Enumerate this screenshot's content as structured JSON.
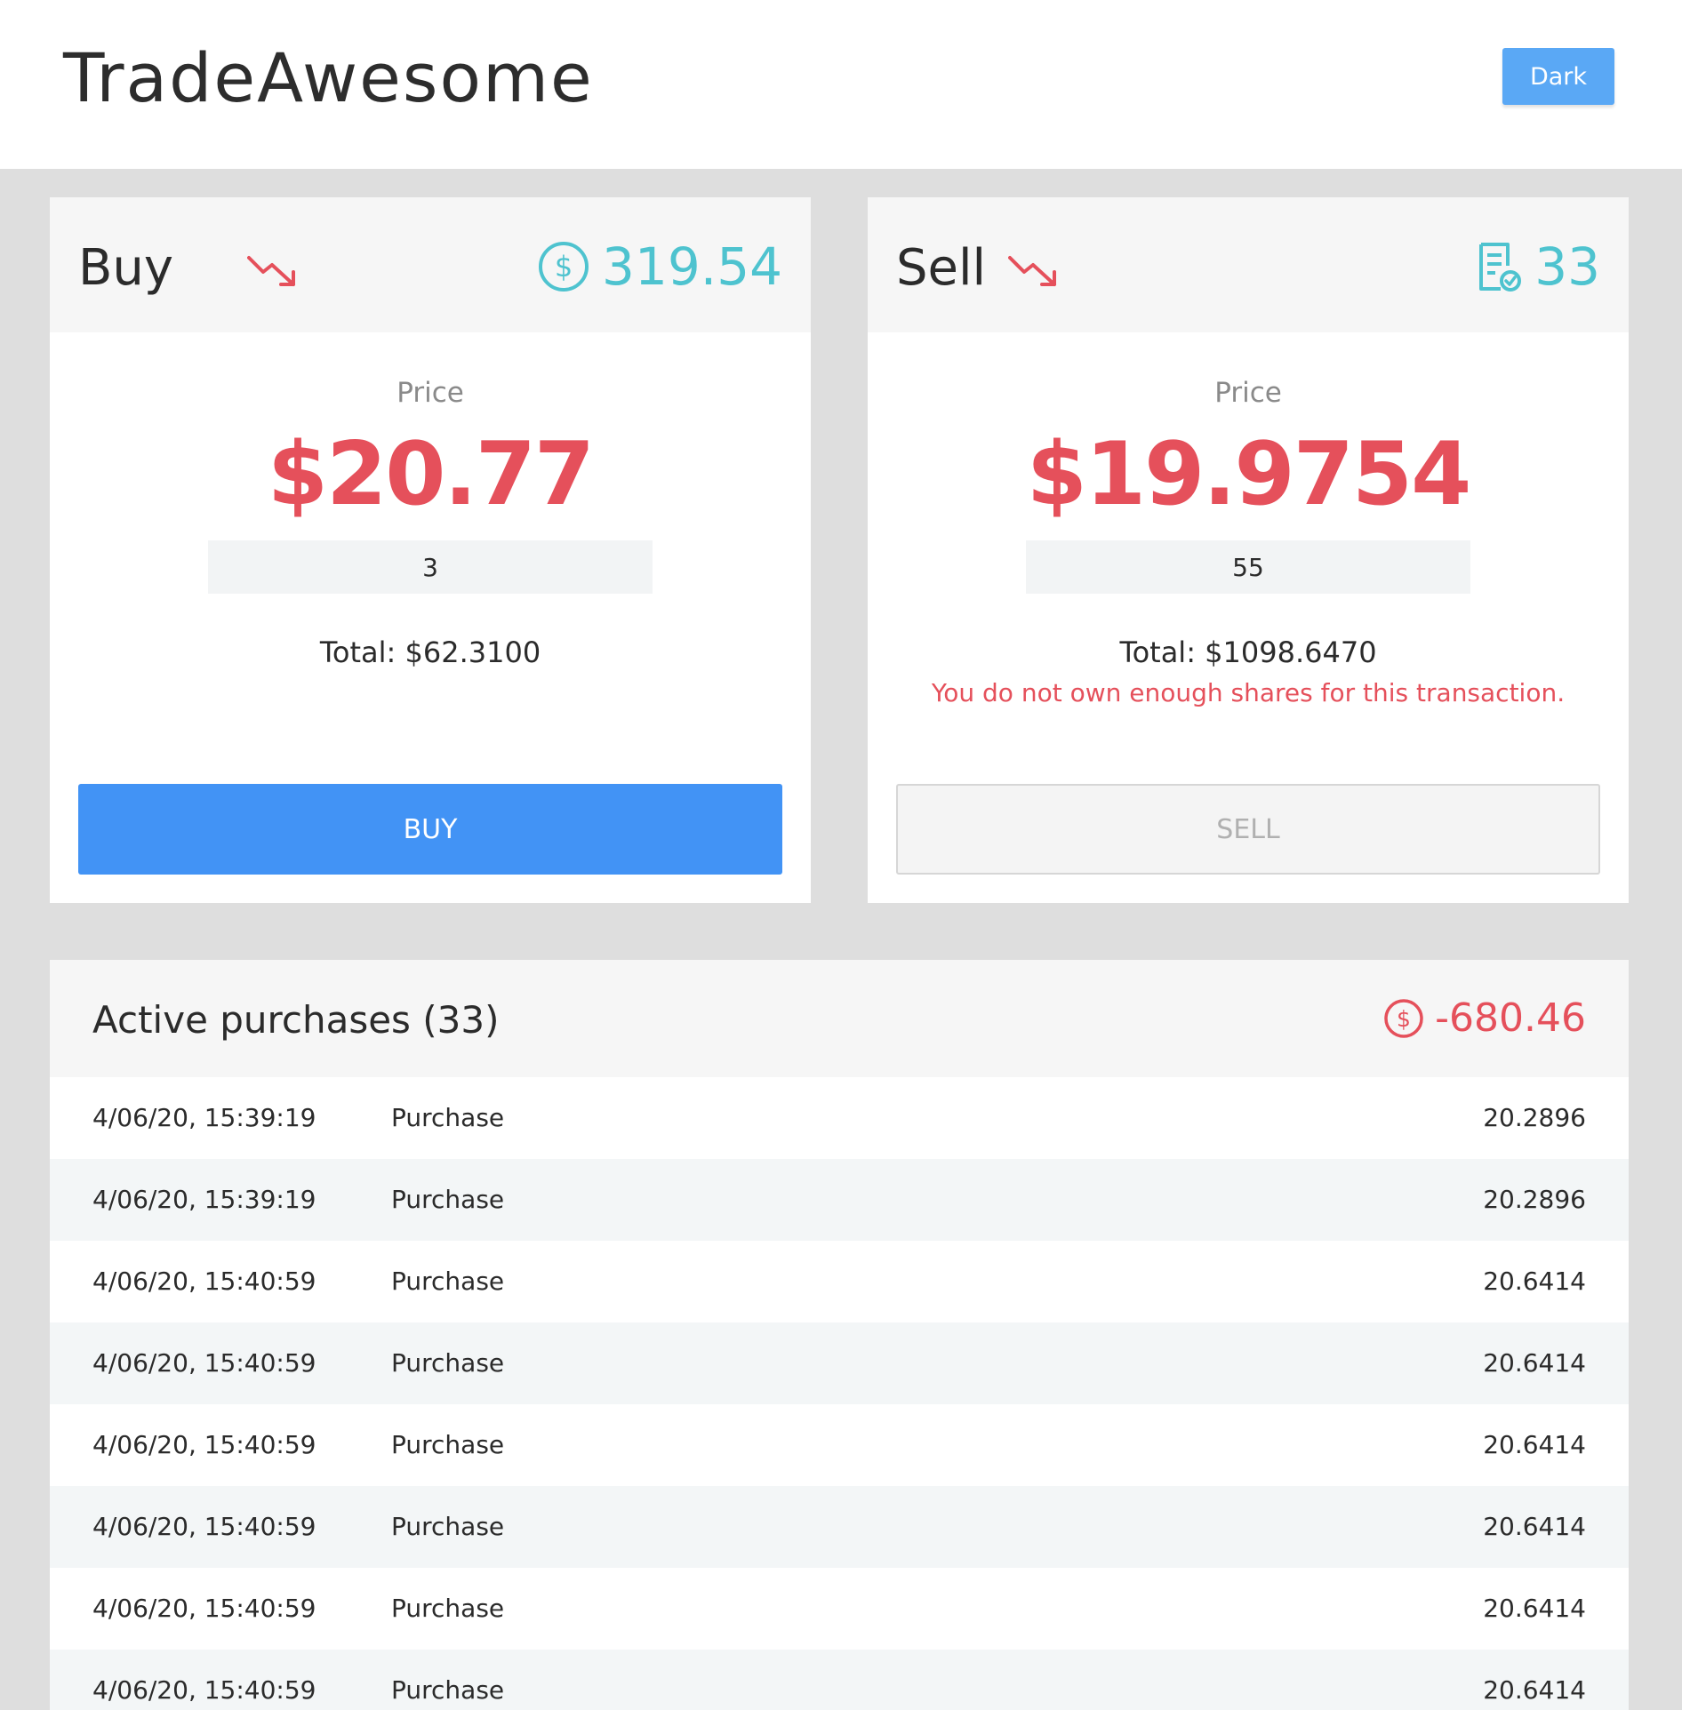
{
  "app": {
    "title": "TradeAwesome",
    "theme_button": "Dark"
  },
  "buy": {
    "title": "Buy",
    "trend_icon": "trending-down-icon",
    "metric_icon": "dollar-circle-icon",
    "metric_value": "319.54",
    "price_label": "Price",
    "price": "$20.77",
    "quantity": "3",
    "total": "Total: $62.3100",
    "button": "BUY"
  },
  "sell": {
    "title": "Sell",
    "trend_icon": "trending-down-icon",
    "metric_icon": "receipt-check-icon",
    "metric_value": "33",
    "price_label": "Price",
    "price": "$19.9754",
    "quantity": "55",
    "total": "Total: $1098.6470",
    "error": "You do not own enough shares for this transaction.",
    "button": "SELL"
  },
  "purchases": {
    "title": "Active purchases (33)",
    "metric_icon": "dollar-circle-icon",
    "metric_value": "-680.46",
    "rows": [
      {
        "date": "4/06/20, 15:39:19",
        "kind": "Purchase",
        "amount": "20.2896"
      },
      {
        "date": "4/06/20, 15:39:19",
        "kind": "Purchase",
        "amount": "20.2896"
      },
      {
        "date": "4/06/20, 15:40:59",
        "kind": "Purchase",
        "amount": "20.6414"
      },
      {
        "date": "4/06/20, 15:40:59",
        "kind": "Purchase",
        "amount": "20.6414"
      },
      {
        "date": "4/06/20, 15:40:59",
        "kind": "Purchase",
        "amount": "20.6414"
      },
      {
        "date": "4/06/20, 15:40:59",
        "kind": "Purchase",
        "amount": "20.6414"
      },
      {
        "date": "4/06/20, 15:40:59",
        "kind": "Purchase",
        "amount": "20.6414"
      },
      {
        "date": "4/06/20, 15:40:59",
        "kind": "Purchase",
        "amount": "20.6414"
      }
    ]
  },
  "colors": {
    "accent_blue": "#4293f5",
    "teal": "#4ec3cf",
    "negative_red": "#e5505b"
  }
}
